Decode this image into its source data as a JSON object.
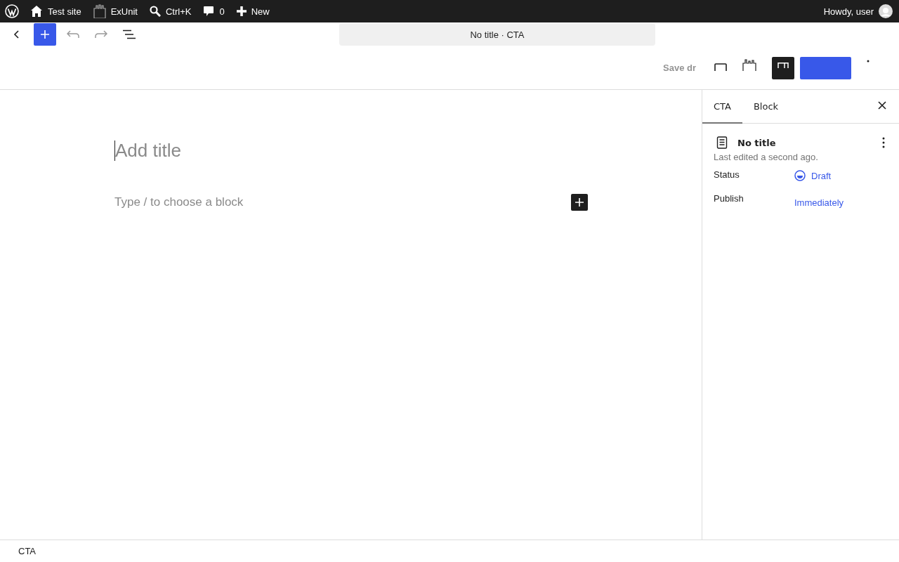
{
  "admin_bar": {
    "items": [
      {
        "kind": "home",
        "label": "Test site"
      },
      {
        "kind": "plugin",
        "label": "ExUnit"
      },
      {
        "kind": "search",
        "label": "Ctrl+K"
      },
      {
        "kind": "comments",
        "label": "0"
      },
      {
        "kind": "new",
        "label": "New"
      }
    ],
    "greeting": "Howdy, user"
  },
  "toolbar": {
    "document_title": "No title · CTA",
    "save_draft": "Save dr"
  },
  "editor": {
    "title_placeholder": "Add title",
    "block_placeholder": "Type / to choose a block"
  },
  "sidebar": {
    "tabs": [
      {
        "label": "CTA",
        "selected": true
      },
      {
        "label": "Block",
        "selected": false
      }
    ],
    "post_title": "No title",
    "last_edited": "Last edited a second ago.",
    "fields": [
      {
        "kind": "status",
        "label": "Status",
        "value": "Draft"
      },
      {
        "kind": "link",
        "label": "Publish",
        "value": "Immediately"
      }
    ]
  },
  "breadcrumb": "CTA"
}
